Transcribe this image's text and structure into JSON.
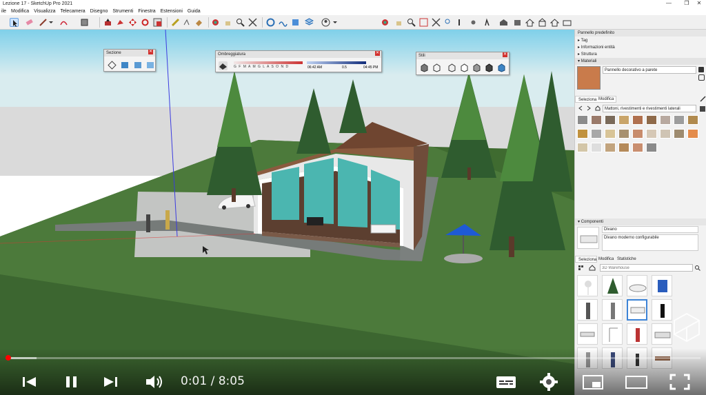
{
  "window": {
    "title": "Lezione 17 - SketchUp Pro 2021",
    "controls": [
      "—",
      "❐",
      "✕"
    ]
  },
  "menu": [
    "ile",
    "Modifica",
    "Visualizza",
    "Telecamera",
    "Disegno",
    "Strumenti",
    "Finestra",
    "Estensioni",
    "Guida"
  ],
  "toolwindows": {
    "section": {
      "title": "Sezione"
    },
    "shadows": {
      "title": "Ombreggiatura",
      "months": "G F M A M G L A S O N D",
      "time_start": "06:42 AM",
      "midday": "0.5",
      "time_end": "04:45 PM"
    },
    "styles": {
      "title": "Stili"
    }
  },
  "tray": {
    "title": "Pannello predefinito",
    "sections": [
      "Tag",
      "Informazioni entità",
      "Struttura",
      "Materiali"
    ],
    "material": {
      "name": "Pannello decorativo a parete",
      "tabs": [
        "Seleziona",
        "Modifica"
      ],
      "collection": "Mattoni, rivestimenti e rivestimenti laterali"
    },
    "swatch_colors": [
      "#8b8b8b",
      "#9a7a6a",
      "#7a6a5a",
      "#c9a56a",
      "#b0704e",
      "#8e6a4a",
      "#b8a9a0",
      "#9d9d9d",
      "#b08a4e",
      "#c1923e",
      "#a8a8a8",
      "#d8c497",
      "#a7906f",
      "#c88c6c",
      "#d6c8b6",
      "#cfc4b4",
      "#9e8b6f",
      "#e48c4c",
      "#d3c6a8",
      "#dedede",
      "#c2a47e",
      "#b48a5a",
      "#c98e6f",
      "#8a8a8a"
    ],
    "material_color": "#c97b4b",
    "components": {
      "title": "Componenti",
      "item_name": "Divano",
      "item_desc": "Divano moderno configurabile",
      "tabs": [
        "Seleziona",
        "Modifica",
        "Statistiche"
      ],
      "search_placeholder": "3D Warehouse"
    }
  },
  "player": {
    "current_time": "0:01",
    "total_time": "8:05",
    "progress": 0.002,
    "buffered": 0.045,
    "accent": "#ff0000"
  },
  "icons": [
    "select-icon",
    "eraser-icon",
    "line-icon",
    "arc-icon",
    "rectangle-icon",
    "push-pull-icon",
    "move-icon",
    "rotate-icon",
    "scale-icon",
    "tape-icon",
    "text-icon",
    "paint-icon",
    "orbit-icon",
    "pan-icon",
    "zoom-icon",
    "zoom-extents-icon",
    "warehouse-icon",
    "extension-icon",
    "user-icon",
    "home-icon"
  ]
}
